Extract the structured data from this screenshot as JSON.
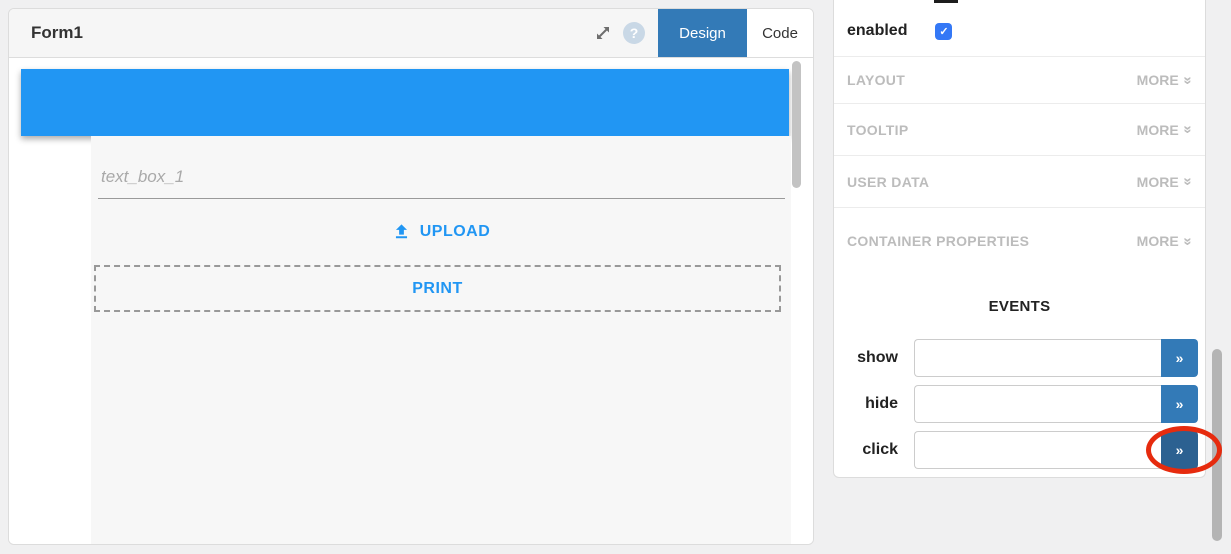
{
  "form_editor": {
    "title": "Form1",
    "tabs": {
      "design": "Design",
      "code": "Code"
    },
    "canvas": {
      "textbox_placeholder": "text_box_1",
      "upload_label": "UPLOAD",
      "print_label": "PRINT"
    }
  },
  "properties_panel": {
    "enabled": {
      "label": "enabled",
      "checked": true
    },
    "sections": [
      {
        "label": "LAYOUT",
        "more": "MORE"
      },
      {
        "label": "TOOLTIP",
        "more": "MORE"
      },
      {
        "label": "USER DATA",
        "more": "MORE"
      },
      {
        "label": "CONTAINER PROPERTIES",
        "more": "MORE"
      }
    ],
    "events": {
      "heading": "EVENTS",
      "rows": [
        {
          "label": "show",
          "value": ""
        },
        {
          "label": "hide",
          "value": ""
        },
        {
          "label": "click",
          "value": "",
          "annotated": true
        }
      ],
      "expand_button_glyph": "»"
    }
  },
  "glyphs": {
    "help": "?",
    "checkmark": "✓",
    "chevron_double": "»"
  },
  "colors": {
    "navbar_blue": "#2196F3",
    "accent_blue": "#337ab7",
    "accent_blue_pressed": "#2c6191",
    "annotation_red": "#e62b0e",
    "checkbox_blue": "#3478f6"
  }
}
